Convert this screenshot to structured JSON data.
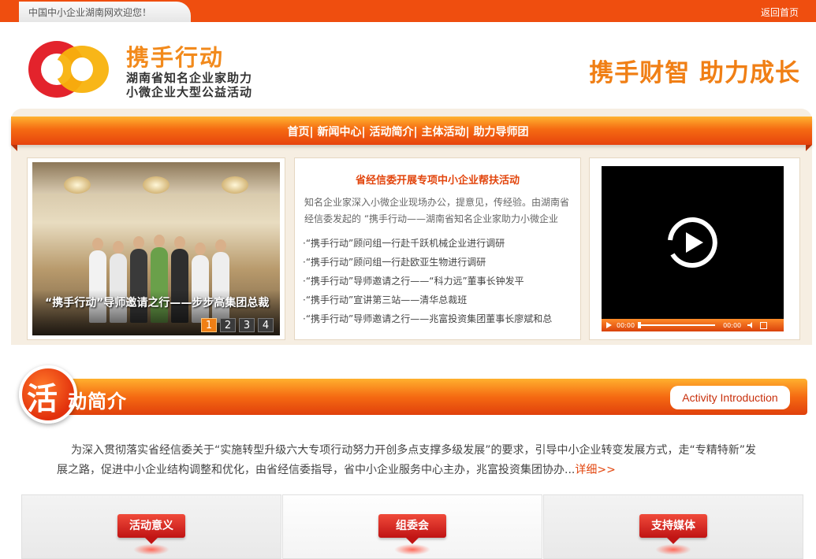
{
  "topbar": {
    "welcome": "中国中小企业湖南网欢迎您！",
    "home_link": "返回首页"
  },
  "header": {
    "logo_title": "携手行动",
    "logo_sub1": "湖南省知名企业家助力",
    "logo_sub2": "小微企业大型公益活动",
    "slogan": "携手财智 助力成长"
  },
  "nav": {
    "items": [
      "首页",
      "新闻中心",
      "活动简介",
      "主体活动",
      "助力导师团"
    ],
    "separator": "|"
  },
  "slider": {
    "caption": "“携手行动”导师邀请之行——步步高集团总裁",
    "pages": [
      "1",
      "2",
      "3",
      "4"
    ],
    "active_page": "1"
  },
  "news": {
    "title": "省经信委开展专项中小企业帮扶活动",
    "intro": "知名企业家深入小微企业现场办公，提意见，传经验。由湖南省经信委发起的 “携手行动——湖南省知名企业家助力小微企业",
    "items": [
      "·“携手行动”顾问组一行赴千跃机械企业进行调研",
      "·“携手行动”顾问组一行赴欧亚生物进行调研",
      "·“携手行动”导师邀请之行——“科力远”董事长钟发平",
      "·“携手行动”宣讲第三站——清华总裁班",
      "·“携手行动”导师邀请之行——兆富投资集团董事长廖斌和总"
    ]
  },
  "video": {
    "time_current": "00:00",
    "time_total": "00:00",
    "progress": 0
  },
  "section": {
    "big_char": "活",
    "title": "动简介",
    "english": "Activity Introduction",
    "intro": "为深入贯彻落实省经信委关于“实施转型升级六大专项行动努力开创多点支撑多级发展”的要求，引导中小企业转变发展方式，走“专精特新”发展之路，促进中小企业结构调整和优化，由省经信委指导，省中小企业服务中心主办，兆富投资集团协办...",
    "more": "详细>>"
  },
  "tiles": [
    "活动意义",
    "组委会",
    "支持媒体"
  ],
  "colors": {
    "accent": "#ef4e0f",
    "brand_orange": "#f28a1c",
    "news_red": "#e2450d",
    "tag_red": "#c01414"
  }
}
